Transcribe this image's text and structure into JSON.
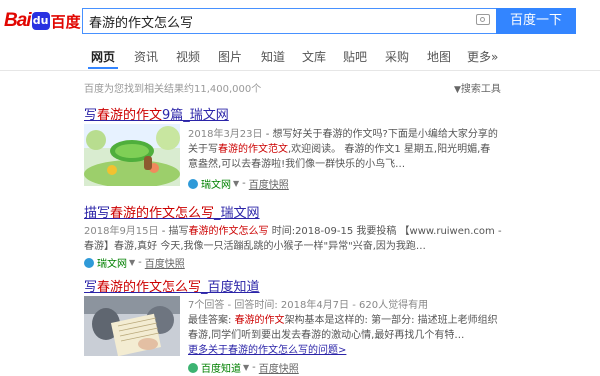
{
  "header": {
    "logo_latin": "Bai",
    "logo_paw": "du",
    "logo_cn": "百度",
    "search_value": "春游的作文怎么写",
    "search_button": "百度一下"
  },
  "tabs": [
    "网页",
    "资讯",
    "视频",
    "图片",
    "知道",
    "文库",
    "贴吧",
    "采购",
    "地图",
    "更多»"
  ],
  "stats": "百度为您找到相关结果约11,400,000个",
  "search_tools": "搜索工具",
  "results": [
    {
      "title_pre": "写",
      "title_hl": "春游的作文",
      "title_post": "9篇_瑞文网",
      "snippet_date": "2018年3月23日",
      "snippet_1": "想写好关于春游的作文吗?下面是小编给大家分享的",
      "snippet_2_pre": "关于写",
      "snippet_2_hl": "春游的作文范文",
      "snippet_2_post": ",欢迎阅读。 春游的作文1 星期五,阳光明媚,春",
      "snippet_3": "意盎然,可以去春游啦!我们像一群快乐的小鸟飞…",
      "source": "瑞文网",
      "cache": "百度快照"
    },
    {
      "title_pre": "描写",
      "title_hl": "春游的作文怎么写",
      "title_post": "_瑞文网",
      "snippet_date": "2018年9月15日",
      "snippet_1_pre": "描写",
      "snippet_1_hl": "春游的作文怎么写",
      "snippet_1_post": " 时间:2018-09-15 我要投稿 【www.ruiwen.com -",
      "snippet_2": "春游】春游,真好 今天,我像一只活蹦乱跳的小猴子一样\"异常\"兴奋,因为我跑…",
      "source": "瑞文网",
      "cache": "百度快照"
    },
    {
      "title_pre": "写",
      "title_hl": "春游的作文怎么写",
      "title_post": "_百度知道",
      "meta": "7个回答 - 回答时间: 2018年4月7日 - 620人觉得有用",
      "best_label": "最佳答案: ",
      "best_hl": "春游的作文",
      "best_post": "架构基本是这样的: 第一部分: 描述班上老师组织",
      "snippet_2": "春游,同学们听到要出发去春游的激动心情,最好再找几个有特…",
      "more": "更多关于春游的作文怎么写的问题>",
      "source": "百度知道",
      "cache": "百度快照"
    }
  ],
  "colors": {
    "brand_red": "#e10601",
    "brand_blue": "#3385ff",
    "link": "#2b24a8",
    "highlight": "#c00"
  }
}
